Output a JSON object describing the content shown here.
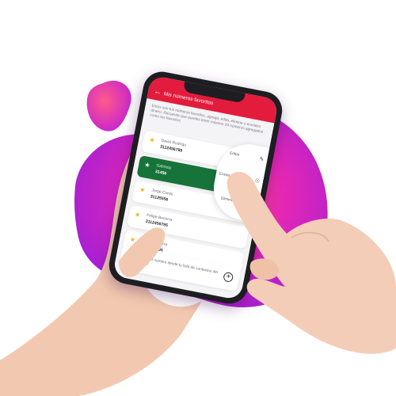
{
  "app": {
    "header_title": "Mis números favoritos",
    "description": "Estos son tus números favoritos, agrega, edita, elimina o envíales dinero. Recuerda que puedes tener máximo 20 números agregados como tus favoritos",
    "back_icon": "arrow-left-icon"
  },
  "contacts": [
    {
      "name": "David Rodrígu",
      "number": "3112456789",
      "active": false
    },
    {
      "name": "Gabriela",
      "number": "31456",
      "active": true
    },
    {
      "name": "Jorge Cordo",
      "number": "31125556",
      "active": false
    },
    {
      "name": "Felipe Becerra",
      "number": "3112456795",
      "active": false
    },
    {
      "name": "Felipe Becerra",
      "number": "3112456795",
      "active": false
    }
  ],
  "context_menu": {
    "edit_label": "Editar",
    "send_label": "Enviar dinero",
    "delete_label": "Eliminar"
  },
  "footer": {
    "text": "Busca el número desde tu lista de contactos del celular",
    "plus_symbol": "+"
  },
  "colors": {
    "header": "#e31b3c",
    "active_card": "#16733a",
    "star": "#f3b21a",
    "blob_main": "#c21fd6"
  }
}
